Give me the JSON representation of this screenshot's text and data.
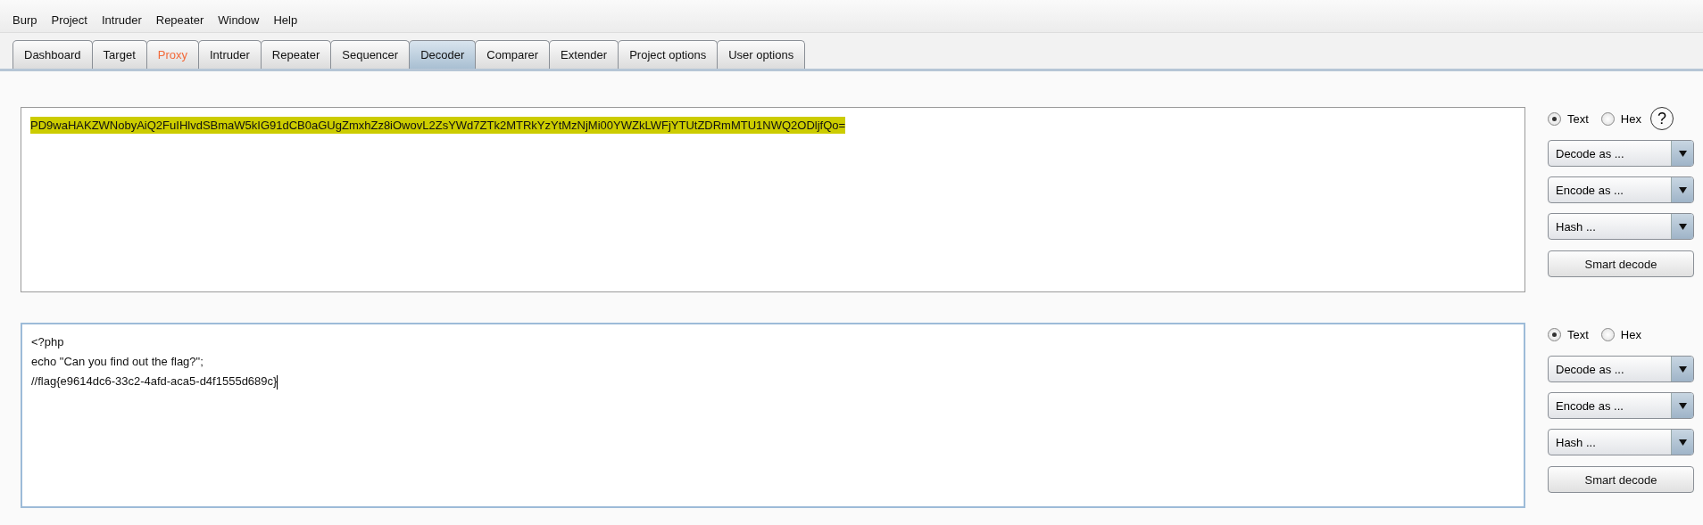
{
  "menu": [
    "Burp",
    "Project",
    "Intruder",
    "Repeater",
    "Window",
    "Help"
  ],
  "tabs": [
    {
      "label": "Dashboard",
      "selected": false,
      "alert": false
    },
    {
      "label": "Target",
      "selected": false,
      "alert": false
    },
    {
      "label": "Proxy",
      "selected": false,
      "alert": true
    },
    {
      "label": "Intruder",
      "selected": false,
      "alert": false
    },
    {
      "label": "Repeater",
      "selected": false,
      "alert": false
    },
    {
      "label": "Sequencer",
      "selected": false,
      "alert": false
    },
    {
      "label": "Decoder",
      "selected": true,
      "alert": false
    },
    {
      "label": "Comparer",
      "selected": false,
      "alert": false
    },
    {
      "label": "Extender",
      "selected": false,
      "alert": false
    },
    {
      "label": "Project options",
      "selected": false,
      "alert": false
    },
    {
      "label": "User options",
      "selected": false,
      "alert": false
    }
  ],
  "panels": [
    {
      "lines": [
        "PD9waHAKZWNobyAiQ2FuIHlvdSBmaW5kIG91dCB0aGUgZmxhZz8iOwovL2ZsYWd7ZTk2MTRkYzYtMzNjMi00YWZkLWFjYTUtZDRmMTU1NWQ2ODljfQo="
      ],
      "text_selected": true,
      "focused": false,
      "modes": [
        {
          "label": "Text",
          "selected": true
        },
        {
          "label": "Hex",
          "selected": false
        }
      ],
      "help": "?",
      "dropdowns": [
        "Decode as ...",
        "Encode as ...",
        "Hash ..."
      ],
      "button": "Smart decode"
    },
    {
      "lines": [
        "<?php",
        "echo \"Can you find out the flag?\";",
        "//flag{e9614dc6-33c2-4afd-aca5-d4f1555d689c}"
      ],
      "text_selected": false,
      "focused": true,
      "modes": [
        {
          "label": "Text",
          "selected": true
        },
        {
          "label": "Hex",
          "selected": false
        }
      ],
      "dropdowns": [
        "Decode as ...",
        "Encode as ...",
        "Hash ..."
      ],
      "button": "Smart decode"
    }
  ]
}
